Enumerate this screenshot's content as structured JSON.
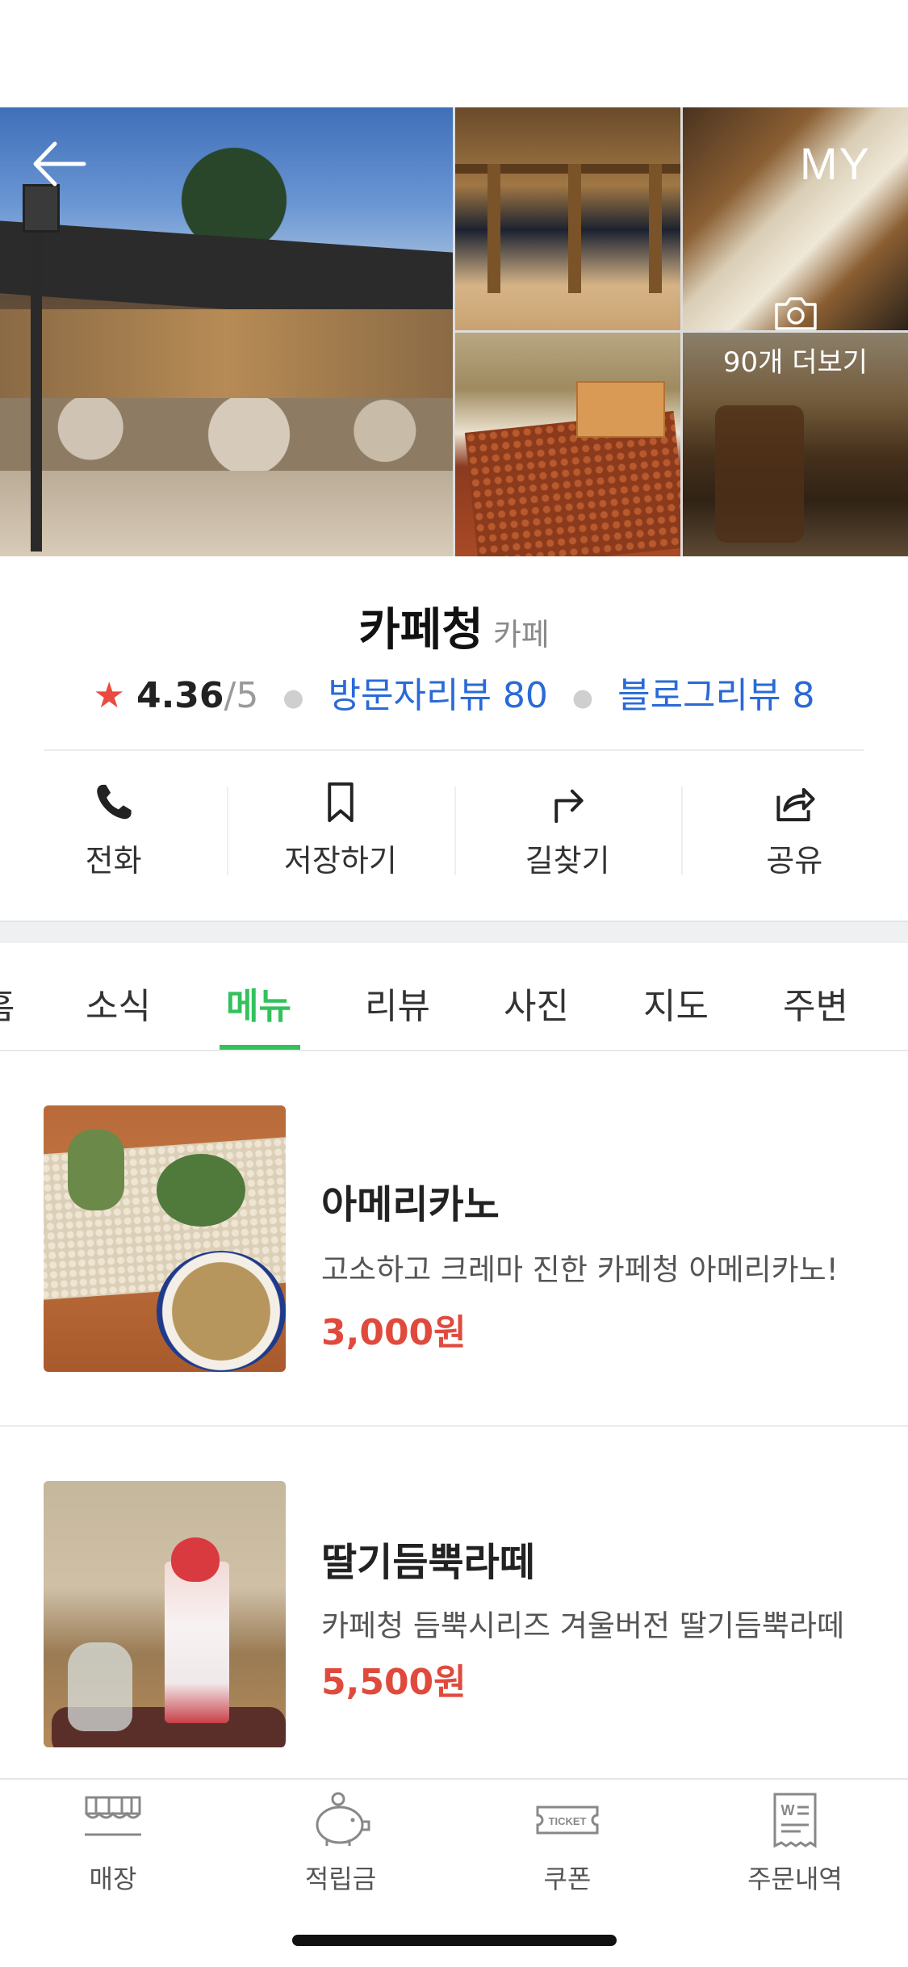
{
  "header": {
    "my_label": "MY",
    "more_photos_label": "90개 더보기"
  },
  "place": {
    "name": "카페청",
    "category": "카페",
    "star": "★",
    "rating": "4.36",
    "rating_max": "/5",
    "visitor_reviews": "방문자리뷰 80",
    "blog_reviews": "블로그리뷰 8"
  },
  "actions": [
    {
      "label": "전화",
      "icon": "phone-icon"
    },
    {
      "label": "저장하기",
      "icon": "bookmark-icon"
    },
    {
      "label": "길찾기",
      "icon": "directions-icon"
    },
    {
      "label": "공유",
      "icon": "share-icon"
    }
  ],
  "tabs": [
    {
      "label": "홈"
    },
    {
      "label": "소식"
    },
    {
      "label": "메뉴"
    },
    {
      "label": "리뷰"
    },
    {
      "label": "사진"
    },
    {
      "label": "지도"
    },
    {
      "label": "주변"
    }
  ],
  "active_tab": "메뉴",
  "menu": [
    {
      "name": "아메리카노",
      "description": "고소하고 크레마 진한 카페청 아메리카노!",
      "price": "3,000원"
    },
    {
      "name": "딸기듬뿍라떼",
      "description": "카페청 듬뿍시리즈 겨울버전 딸기듬뿍라떼",
      "price": "5,500원"
    }
  ],
  "bottom_nav": [
    {
      "label": "매장",
      "icon": "store-icon"
    },
    {
      "label": "적립금",
      "icon": "piggy-bank-icon"
    },
    {
      "label": "쿠폰",
      "icon": "ticket-icon"
    },
    {
      "label": "주문내역",
      "icon": "receipt-icon"
    }
  ],
  "icon_text": {
    "ticket": "TICKET",
    "won": "W"
  },
  "colors": {
    "accent_green": "#33c15c",
    "link_blue": "#2a6ad6",
    "price_red": "#e04a3c",
    "star_red": "#ea4a3f"
  }
}
